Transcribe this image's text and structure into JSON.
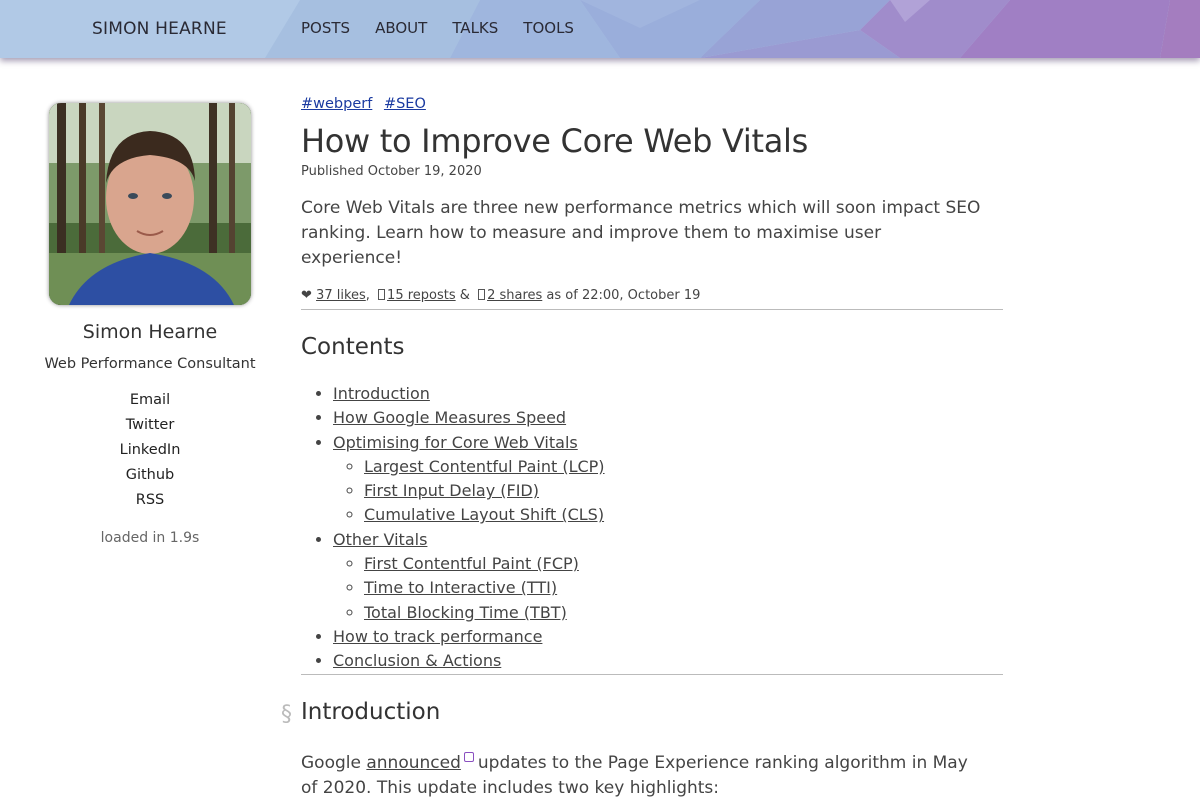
{
  "header": {
    "brand": "SIMON HEARNE",
    "nav": [
      "POSTS",
      "ABOUT",
      "TALKS",
      "TOOLS"
    ]
  },
  "sidebar": {
    "name": "Simon Hearne",
    "role": "Web Performance Consultant",
    "links": [
      "Email",
      "Twitter",
      "LinkedIn",
      "Github",
      "RSS"
    ],
    "loaded": "loaded in 1.9s"
  },
  "post": {
    "tags": [
      "#webperf",
      "#SEO"
    ],
    "title": "How to Improve Core Web Vitals",
    "published": "Published October 19, 2020",
    "lead": "Core Web Vitals are three new performance metrics which will soon impact SEO ranking. Learn how to measure and improve them to maximise user experience!",
    "social": {
      "heart": "❤",
      "likes": "37 likes",
      "reposts": "15 reposts",
      "amp": "&",
      "shares": "2 shares",
      "as_of": "as of 22:00, October 19"
    }
  },
  "contents": {
    "heading": "Contents",
    "items": [
      "Introduction",
      "How Google Measures Speed",
      "Optimising for Core Web Vitals",
      "Largest Contentful Paint (LCP)",
      "First Input Delay (FID)",
      "Cumulative Layout Shift (CLS)",
      "Other Vitals",
      "First Contentful Paint (FCP)",
      "Time to Interactive (TTI)",
      "Total Blocking Time (TBT)",
      "How to track performance",
      "Conclusion & Actions"
    ]
  },
  "intro": {
    "anchor": "§",
    "heading": "Introduction",
    "text_before": "Google",
    "link": "announced",
    "text_after": "updates to the Page Experience ranking algorithm in May of 2020. This update includes two key highlights:"
  },
  "colors": {
    "header_light": "#a9c4e4",
    "header_purple": "#a37fc3",
    "link_blue": "#1a3aa0"
  }
}
